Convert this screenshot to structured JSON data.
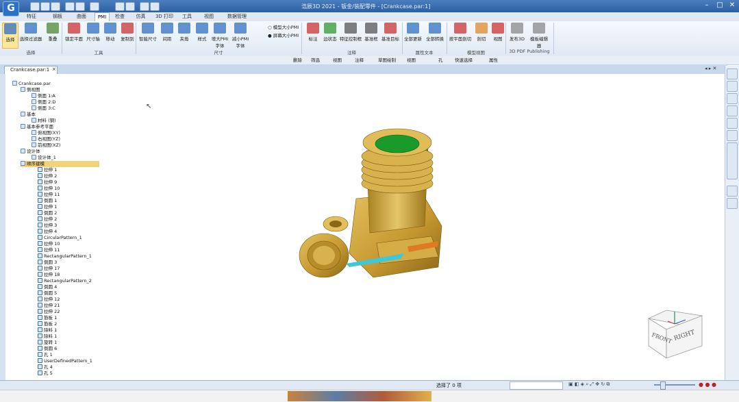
{
  "app": {
    "logo": "G",
    "title": "浩辰3D 2021 - 钣金/装配零件 - [Crankcase.par:1]"
  },
  "tabs": [
    "特征",
    "钢板",
    "曲面",
    "PMI",
    "检查",
    "仿真",
    "3D 打印",
    "工具",
    "视图",
    "数据管理"
  ],
  "active_tab": "PMI",
  "ribbon": {
    "buttons": [
      {
        "label": "选择",
        "icon": "cursor-icon"
      },
      {
        "label": "选择过滤器",
        "icon": "filter-icon"
      },
      {
        "label": "重叠",
        "icon": "overlap-icon"
      },
      {
        "label": "锁定平面",
        "icon": "plane-lock-icon"
      },
      {
        "label": "尺寸轴",
        "icon": "dimension-axis-icon"
      },
      {
        "label": "移动",
        "icon": "move-icon"
      },
      {
        "label": "复制到",
        "icon": "copy-to-icon"
      },
      {
        "label": "智能尺寸",
        "icon": "smart-dimension-icon"
      },
      {
        "label": "间距",
        "icon": "spacing-icon"
      },
      {
        "label": "夹角",
        "icon": "angle-icon"
      },
      {
        "label": "样式",
        "icon": "style-icon"
      },
      {
        "label": "增大PMI字体",
        "icon": "font-grow-icon"
      },
      {
        "label": "减小PMI字体",
        "icon": "font-shrink-icon"
      },
      {
        "label": "标注",
        "icon": "callout-icon"
      },
      {
        "label": "边状态",
        "icon": "edge-state-icon"
      },
      {
        "label": "特征控制框",
        "icon": "feature-control-icon"
      },
      {
        "label": "基准框",
        "icon": "datum-frame-icon"
      },
      {
        "label": "基准目标",
        "icon": "datum-target-icon"
      },
      {
        "label": "全部更新",
        "icon": "update-all-icon"
      },
      {
        "label": "全部转换",
        "icon": "convert-all-icon"
      },
      {
        "label": "按平面剖切",
        "icon": "plane-section-icon"
      },
      {
        "label": "剖切",
        "icon": "section-icon"
      },
      {
        "label": "视图",
        "icon": "view-icon"
      },
      {
        "label": "发布3D",
        "icon": "publish-3d-icon"
      },
      {
        "label": "模板编辑器",
        "icon": "template-editor-icon"
      }
    ],
    "small_options": [
      "模型大小PMI",
      "屏幕大小PMI"
    ],
    "groups": [
      "选择",
      "工具",
      "尺寸",
      "注释",
      "属性文本",
      "模型视图",
      "3D PDF Publishing"
    ]
  },
  "commandbar": [
    "删除",
    "筛选",
    "视图",
    "注释",
    "草图绘制",
    "视图",
    "孔",
    "快速选择",
    "属性"
  ],
  "document": {
    "tab_label": "Crankcase.par:1"
  },
  "tree": [
    {
      "text": "Crankcase.par",
      "level": 0
    },
    {
      "text": "侧视图",
      "level": 1
    },
    {
      "text": "侧面 1:A",
      "level": 2
    },
    {
      "text": "侧面 2:D",
      "level": 2
    },
    {
      "text": "侧面 3:C",
      "level": 2
    },
    {
      "text": "基本",
      "level": 1
    },
    {
      "text": "材料 (钢)",
      "level": 2
    },
    {
      "text": "基本参考平面",
      "level": 1
    },
    {
      "text": "俯视图(XY)",
      "level": 2
    },
    {
      "text": "右视图(YZ)",
      "level": 2
    },
    {
      "text": "前视图(XZ)",
      "level": 2
    },
    {
      "text": "设计体",
      "level": 1
    },
    {
      "text": "设计体_1",
      "level": 2
    },
    {
      "text": "顺序建模",
      "level": 1,
      "selected": true
    },
    {
      "text": "拉伸 1",
      "level": 3
    },
    {
      "text": "拉伸 2",
      "level": 3
    },
    {
      "text": "拉伸 9",
      "level": 3
    },
    {
      "text": "拉伸 10",
      "level": 3
    },
    {
      "text": "拉伸 11",
      "level": 3
    },
    {
      "text": "倒圆 1",
      "level": 3
    },
    {
      "text": "拉伸 1",
      "level": 3
    },
    {
      "text": "倒圆 2",
      "level": 3
    },
    {
      "text": "拉伸 2",
      "level": 3
    },
    {
      "text": "拉伸 3",
      "level": 3
    },
    {
      "text": "拉伸 4",
      "level": 3
    },
    {
      "text": "CircularPattern_1",
      "level": 3
    },
    {
      "text": "拉伸 10",
      "level": 3
    },
    {
      "text": "拉伸 11",
      "level": 3
    },
    {
      "text": "RectangularPattern_1",
      "level": 3
    },
    {
      "text": "倒圆 3",
      "level": 3
    },
    {
      "text": "拉伸 17",
      "level": 3
    },
    {
      "text": "拉伸 18",
      "level": 3
    },
    {
      "text": "RectangularPattern_2",
      "level": 3
    },
    {
      "text": "倒圆 4",
      "level": 3
    },
    {
      "text": "倒圆 5",
      "level": 3
    },
    {
      "text": "拉伸 12",
      "level": 3
    },
    {
      "text": "拉伸 21",
      "level": 3
    },
    {
      "text": "拉伸 22",
      "level": 3
    },
    {
      "text": "筋板 1",
      "level": 3
    },
    {
      "text": "筋板 2",
      "level": 3
    },
    {
      "text": "除料 1",
      "level": 3
    },
    {
      "text": "除料 1",
      "level": 3
    },
    {
      "text": "旋转 1",
      "level": 3
    },
    {
      "text": "倒圆 6",
      "level": 3
    },
    {
      "text": "孔 1",
      "level": 3
    },
    {
      "text": "UserDefinedPattern_1",
      "level": 3
    },
    {
      "text": "孔 4",
      "level": 3
    },
    {
      "text": "孔 5",
      "level": 3
    }
  ],
  "viewcube": {
    "left": "RIGHT",
    "front": "FRONT"
  },
  "status": {
    "text": "选择了 0 项"
  },
  "colors": {
    "model_body": "#c9a23f",
    "bore": "#1a9a2a",
    "accent_cyan": "#3ec7d8",
    "accent_orange": "#e07a22"
  }
}
